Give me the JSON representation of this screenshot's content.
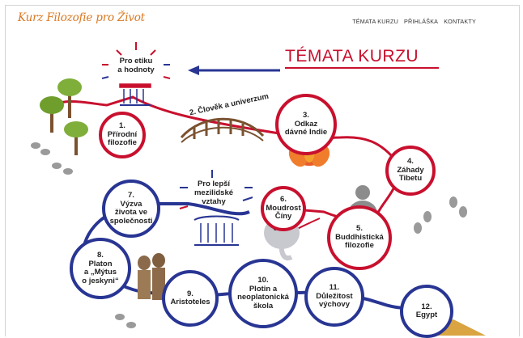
{
  "header": {
    "logo": "Kurz Filozofie pro Život",
    "nav": [
      "TÉMATA KURZU",
      "PŘIHLÁŠKA",
      "KONTAKTY"
    ]
  },
  "page_title": "TÉMATA KURZU",
  "side_labels": {
    "ethics": "Pro etiku\na hodnoty",
    "relations": "Pro lepší\nmezilidské\nvztahy",
    "bridge": "2. Člověk a univerzum"
  },
  "topics": [
    {
      "num": "1.",
      "label": "Přírodní\nfilozofie"
    },
    {
      "num": "3.",
      "label": "Odkaz\ndávné Indie"
    },
    {
      "num": "4.",
      "label": "Záhady\nTibetu"
    },
    {
      "num": "5.",
      "label": "Buddhistická\nfilozofie"
    },
    {
      "num": "6.",
      "label": "Moudrost\nČíny"
    },
    {
      "num": "7.",
      "label": "Výzva\nživota ve\nspolečnosti"
    },
    {
      "num": "8.",
      "label": "Platon\na „Mýtus\no jeskyni“"
    },
    {
      "num": "9.",
      "label": "Aristoteles"
    },
    {
      "num": "10.",
      "label": "Plotin a\nneoplatonická\nškola"
    },
    {
      "num": "11.",
      "label": "Důležitost\nvýchovy"
    },
    {
      "num": "12.",
      "label": "Egypt"
    }
  ],
  "colors": {
    "red": "#c8102e",
    "blue": "#283593",
    "orange": "#d9771f"
  }
}
